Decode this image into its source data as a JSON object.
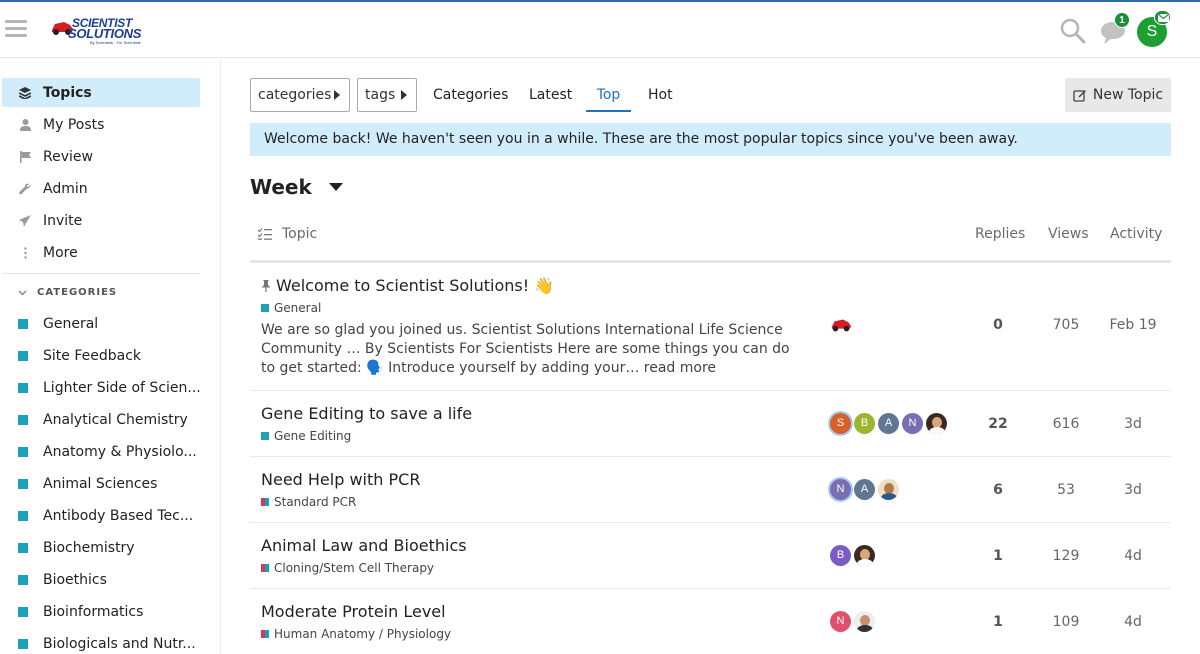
{
  "header": {
    "logo_line1": "SCIENTIST",
    "logo_line2": "SOLUTIONS",
    "logo_tagline": "By Scientists · For Scientists",
    "notification_count": "1",
    "user_initial": "S"
  },
  "sidebar": {
    "items": [
      {
        "label": "Topics",
        "icon": "layers-icon"
      },
      {
        "label": "My Posts",
        "icon": "user-icon"
      },
      {
        "label": "Review",
        "icon": "flag-icon"
      },
      {
        "label": "Admin",
        "icon": "wrench-icon"
      },
      {
        "label": "Invite",
        "icon": "paper-plane-icon"
      },
      {
        "label": "More",
        "icon": "ellipsis-vertical-icon"
      }
    ],
    "categories_label": "CATEGORIES",
    "categories": [
      "General",
      "Site Feedback",
      "Lighter Side of Scien...",
      "Analytical Chemistry",
      "Anatomy & Physiolo...",
      "Animal Sciences",
      "Antibody Based Tec...",
      "Biochemistry",
      "Bioethics",
      "Bioinformatics",
      "Biologicals and Nutr..."
    ],
    "category_color": "#1aa3b8"
  },
  "toolbar": {
    "categories_dropdown": "categories",
    "tags_dropdown": "tags",
    "tabs": [
      "Categories",
      "Latest",
      "Top",
      "Hot"
    ],
    "active_tab": "Top",
    "new_topic": "New Topic"
  },
  "banner": "Welcome back! We haven't seen you in a while. These are the most popular topics since you've been away.",
  "period": "Week",
  "table": {
    "headers": {
      "topic": "Topic",
      "replies": "Replies",
      "views": "Views",
      "activity": "Activity"
    },
    "rows": [
      {
        "title": "Welcome to Scientist Solutions! 👋",
        "pinned": true,
        "category": "General",
        "excerpt": "We are so glad you joined us. Scientist Solutions International Life Science Community … By Scientists For Scientists Here are some things you can do to get started: 🗣️ Introduce yourself by adding your… read more",
        "replies": "0",
        "views": "705",
        "activity": "Feb 19"
      },
      {
        "title": "Gene Editing to save a life",
        "category": "Gene Editing",
        "posters": [
          "S",
          "B",
          "A",
          "N",
          "photo"
        ],
        "replies": "22",
        "views": "616",
        "activity": "3d"
      },
      {
        "title": "Need Help with PCR",
        "category": "Standard PCR",
        "posters": [
          "N",
          "A",
          "photo"
        ],
        "replies": "6",
        "views": "53",
        "activity": "3d"
      },
      {
        "title": "Animal Law and Bioethics",
        "category": "Cloning/Stem Cell Therapy",
        "posters": [
          "B",
          "photo"
        ],
        "replies": "1",
        "views": "129",
        "activity": "4d"
      },
      {
        "title": "Moderate Protein Level",
        "category": "Human Anatomy / Physiology",
        "posters": [
          "N",
          "photo"
        ],
        "replies": "1",
        "views": "109",
        "activity": "4d"
      }
    ]
  },
  "colors": {
    "accent": "#1e73be",
    "banner_bg": "#d1ecfa",
    "user_avatar": "#1e9f32"
  }
}
